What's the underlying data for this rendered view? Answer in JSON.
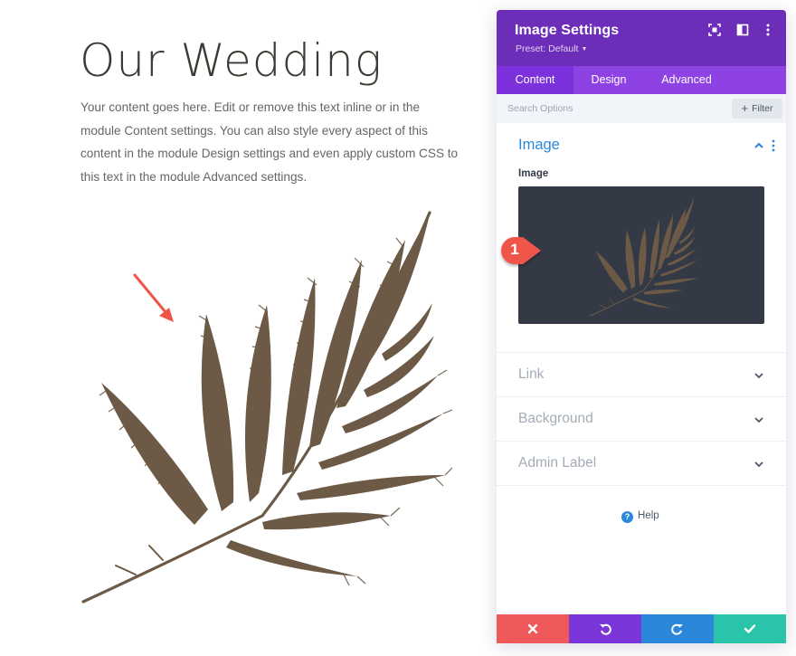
{
  "page": {
    "title": "Our Wedding",
    "body_text": "Your content goes here. Edit or remove this text inline or in the module Content settings. You can also style every aspect of this content in the module Design settings and even apply custom CSS to this text in the module Advanced settings."
  },
  "panel": {
    "title": "Image Settings",
    "preset": "Preset: Default",
    "tabs": [
      {
        "label": "Content",
        "active": true
      },
      {
        "label": "Design",
        "active": false
      },
      {
        "label": "Advanced",
        "active": false
      }
    ],
    "search_placeholder": "Search Options",
    "filter_label": "Filter",
    "image_section": {
      "title": "Image",
      "field_label": "Image"
    },
    "collapsed_sections": [
      "Link",
      "Background",
      "Admin Label"
    ],
    "help_label": "Help",
    "footer_buttons": [
      {
        "name": "discard",
        "icon": "close-icon",
        "color": "#ef5959"
      },
      {
        "name": "undo",
        "icon": "undo-icon",
        "color": "#7a36d9"
      },
      {
        "name": "redo",
        "icon": "redo-icon",
        "color": "#2b87da"
      },
      {
        "name": "save",
        "icon": "check-icon",
        "color": "#29c4a9"
      }
    ]
  },
  "annotation": {
    "step_number": "1"
  },
  "colors": {
    "header": "#6c2eb9",
    "tabs": "#8e42e3",
    "accent_blue": "#2b87da",
    "fern": "#6c5a46",
    "preview_bg": "#333a45"
  }
}
